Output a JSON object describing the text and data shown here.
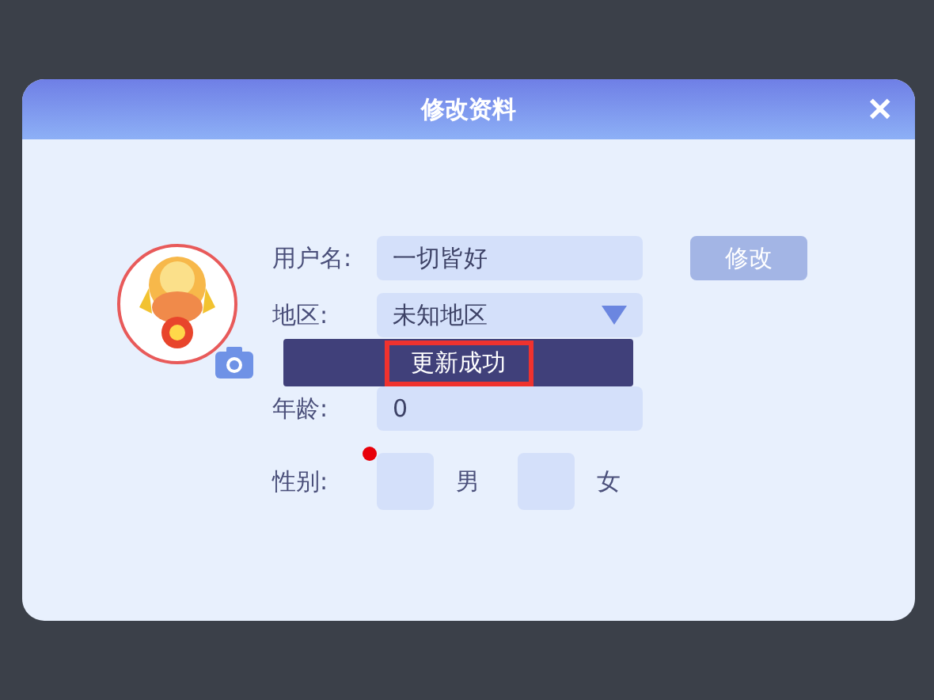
{
  "dialog": {
    "title": "修改资料",
    "close": "✕"
  },
  "fields": [
    {
      "kind": "text",
      "label": "用户名:",
      "value": "一切皆好"
    },
    {
      "kind": "select",
      "label": "地区:",
      "value": "未知地区"
    },
    {
      "kind": "text",
      "label": "年龄:",
      "value": "0"
    }
  ],
  "edit_button": "修改",
  "gender": {
    "label": "性别:",
    "required": true,
    "options": [
      {
        "label": "男",
        "selected": false
      },
      {
        "label": "女",
        "selected": false
      }
    ]
  },
  "toast": {
    "message": "更新成功",
    "highlighted": true
  }
}
